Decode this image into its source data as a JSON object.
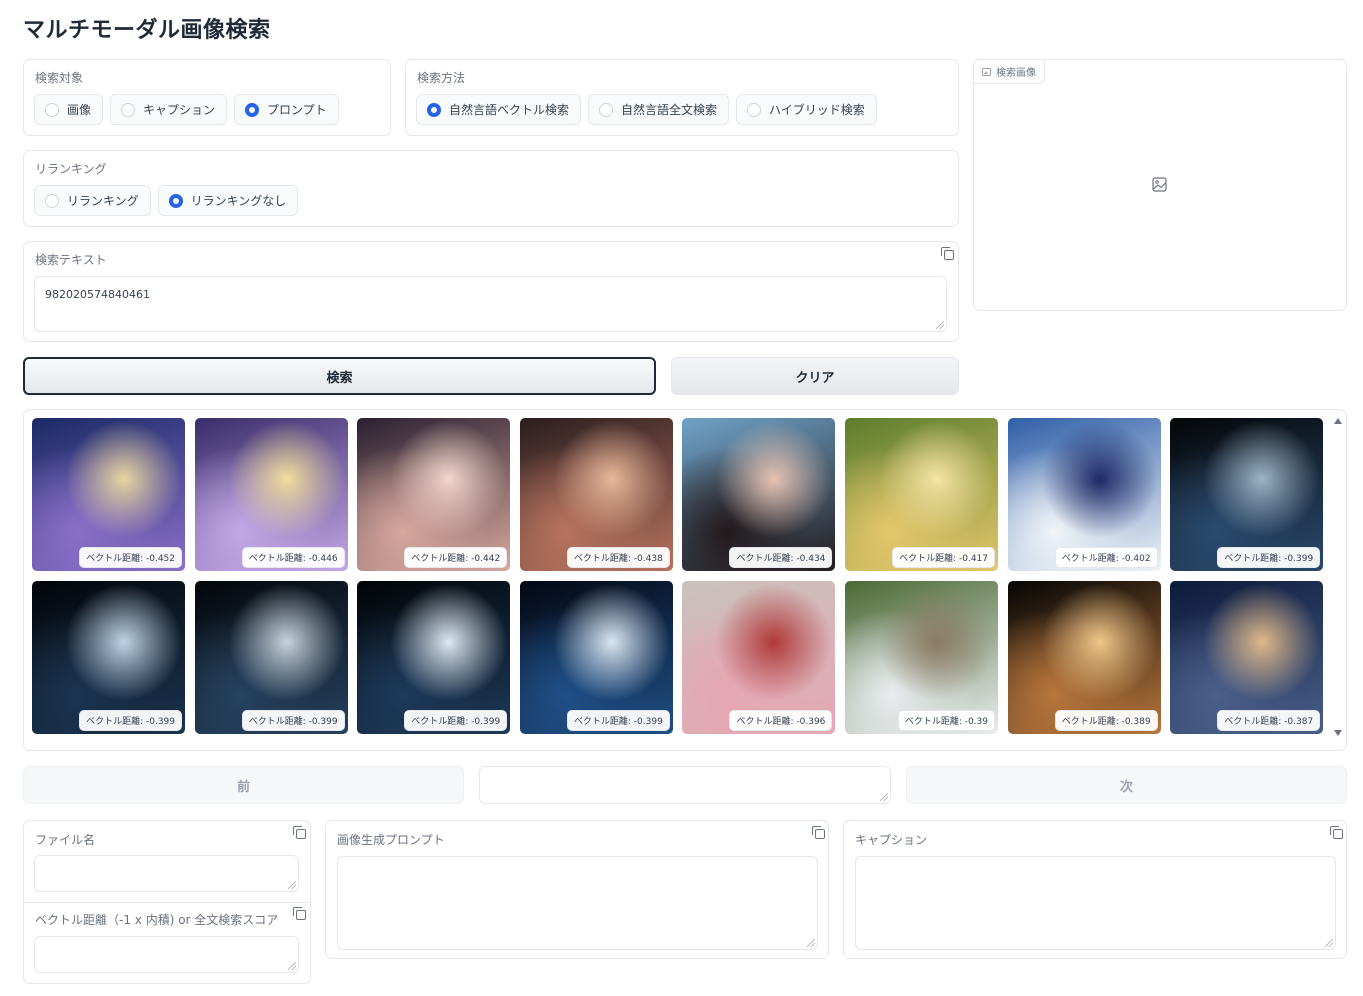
{
  "app": {
    "title": "マルチモーダル画像検索"
  },
  "search_target": {
    "label": "検索対象",
    "options": [
      "画像",
      "キャプション",
      "プロンプト"
    ],
    "selected": "プロンプト"
  },
  "search_method": {
    "label": "検索方法",
    "options": [
      "自然言語ベクトル検索",
      "自然言語全文検索",
      "ハイブリッド検索"
    ],
    "selected": "自然言語ベクトル検索"
  },
  "reranking": {
    "label": "リランキング",
    "options": [
      "リランキング",
      "リランキングなし"
    ],
    "selected": "リランキングなし"
  },
  "search_image": {
    "label": "検索画像"
  },
  "search_text": {
    "label": "検索テキスト",
    "value": "982020574840461"
  },
  "buttons": {
    "search": "検索",
    "clear": "クリア",
    "prev": "前",
    "next": "次"
  },
  "page_input": {
    "value": ""
  },
  "gallery": {
    "items": [
      {
        "caption": "ベクトル距離: -0.452",
        "palette": [
          "#1b2a66",
          "#8a6fc9",
          "#e8d6a0"
        ]
      },
      {
        "caption": "ベクトル距離: -0.446",
        "palette": [
          "#3a2d6b",
          "#c3a8e6",
          "#f1dd9a"
        ]
      },
      {
        "caption": "ベクトル距離: -0.442",
        "palette": [
          "#2a2030",
          "#d7a79d",
          "#f3d6cc"
        ]
      },
      {
        "caption": "ベクトル距離: -0.438",
        "palette": [
          "#2b1d1f",
          "#b7735f",
          "#e9b79a"
        ]
      },
      {
        "caption": "ベクトル距離: -0.434",
        "palette": [
          "#6fa3c9",
          "#231a1c",
          "#e7c3b2"
        ]
      },
      {
        "caption": "ベクトル距離: -0.417",
        "palette": [
          "#5d7d2d",
          "#e3c76c",
          "#f5e3a3"
        ]
      },
      {
        "caption": "ベクトル距離: -0.402",
        "palette": [
          "#2f5fa8",
          "#f0f4f8",
          "#1d2a66"
        ]
      },
      {
        "caption": "ベクトル距離: -0.399",
        "palette": [
          "#050607",
          "#2a4a6e",
          "#9bb3c7"
        ]
      },
      {
        "caption": "ベクトル距離: -0.399",
        "palette": [
          "#03050a",
          "#1a3450",
          "#bfd4e6"
        ]
      },
      {
        "caption": "ベクトル距離: -0.399",
        "palette": [
          "#04060a",
          "#26425f",
          "#c7d3dc"
        ]
      },
      {
        "caption": "ベクトル距離: -0.399",
        "palette": [
          "#020406",
          "#1d3a5a",
          "#dde8f2"
        ]
      },
      {
        "caption": "ベクトル距離: -0.399",
        "palette": [
          "#030713",
          "#1f4f86",
          "#d9e7f4"
        ]
      },
      {
        "caption": "ベクトル距離: -0.396",
        "palette": [
          "#c9c2bc",
          "#e6a6b4",
          "#b03a3a"
        ]
      },
      {
        "caption": "ベクトル距離: -0.39",
        "palette": [
          "#4b6a35",
          "#e9ecef",
          "#8b7a62"
        ]
      },
      {
        "caption": "ベクトル距離: -0.389",
        "palette": [
          "#050505",
          "#b8763c",
          "#f0c68a"
        ]
      },
      {
        "caption": "ベクトル距離: -0.387",
        "palette": [
          "#0c1a3a",
          "#4a5f8a",
          "#e0b98a"
        ]
      }
    ]
  },
  "details": {
    "filename": {
      "label": "ファイル名",
      "value": ""
    },
    "distance": {
      "label": "ベクトル距離（-1 x 内積) or 全文検索スコア",
      "value": ""
    },
    "prompt": {
      "label": "画像生成プロンプト",
      "value": ""
    },
    "caption": {
      "label": "キャプション",
      "value": ""
    }
  },
  "colors": {
    "accent": "#2563eb",
    "border": "#e5e7eb",
    "text": "#374151"
  }
}
